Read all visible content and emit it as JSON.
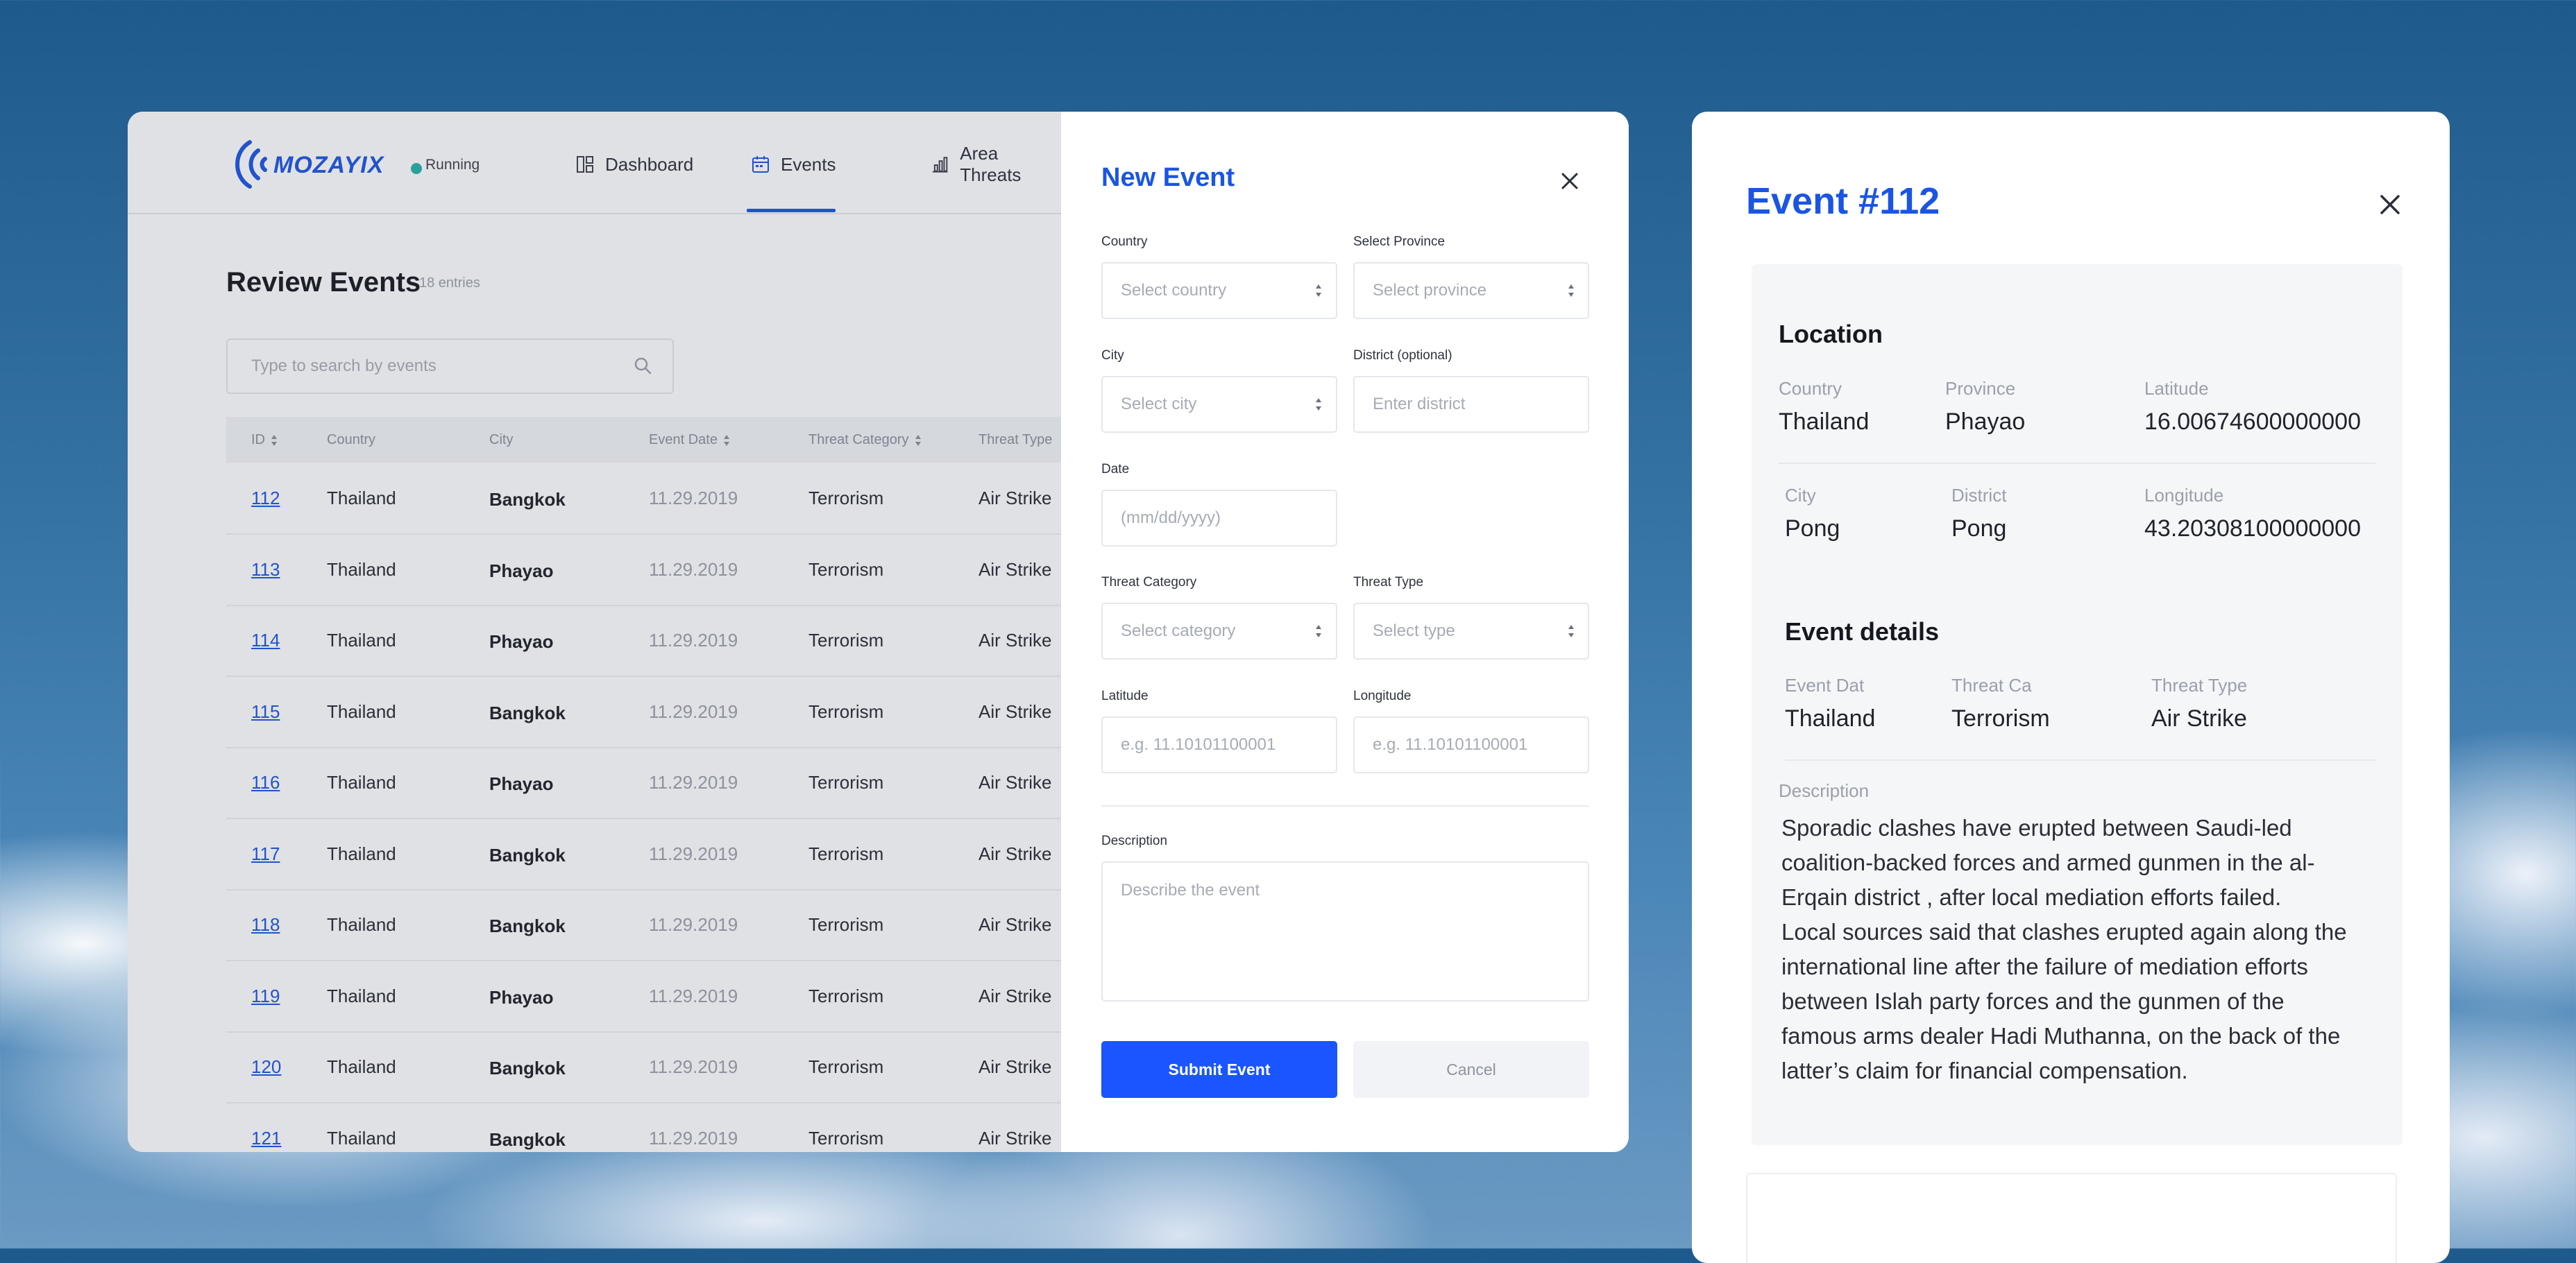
{
  "app": {
    "brand": "MOZAYIX",
    "status": "Running",
    "nav": [
      {
        "label": "Dashboard",
        "icon": "dashboard-icon"
      },
      {
        "label": "Events",
        "icon": "calendar-icon",
        "active": true
      },
      {
        "label": "Area Threats",
        "icon": "bar-chart-icon"
      }
    ],
    "page_title": "Review Events",
    "entries": "18 entries",
    "search_placeholder": "Type to search by events",
    "columns": [
      "ID",
      "Country",
      "City",
      "Event Date",
      "Threat Category",
      "Threat Type"
    ],
    "rows": [
      {
        "id": "112",
        "country": "Thailand",
        "city": "Bangkok",
        "date": "11.29.2019",
        "category": "Terrorism",
        "type": "Air Strike"
      },
      {
        "id": "113",
        "country": "Thailand",
        "city": "Phayao",
        "date": "11.29.2019",
        "category": "Terrorism",
        "type": "Air Strike"
      },
      {
        "id": "114",
        "country": "Thailand",
        "city": "Phayao",
        "date": "11.29.2019",
        "category": "Terrorism",
        "type": "Air Strike"
      },
      {
        "id": "115",
        "country": "Thailand",
        "city": "Bangkok",
        "date": "11.29.2019",
        "category": "Terrorism",
        "type": "Air Strike"
      },
      {
        "id": "116",
        "country": "Thailand",
        "city": "Phayao",
        "date": "11.29.2019",
        "category": "Terrorism",
        "type": "Air Strike"
      },
      {
        "id": "117",
        "country": "Thailand",
        "city": "Bangkok",
        "date": "11.29.2019",
        "category": "Terrorism",
        "type": "Air Strike"
      },
      {
        "id": "118",
        "country": "Thailand",
        "city": "Bangkok",
        "date": "11.29.2019",
        "category": "Terrorism",
        "type": "Air Strike"
      },
      {
        "id": "119",
        "country": "Thailand",
        "city": "Phayao",
        "date": "11.29.2019",
        "category": "Terrorism",
        "type": "Air Strike"
      },
      {
        "id": "120",
        "country": "Thailand",
        "city": "Bangkok",
        "date": "11.29.2019",
        "category": "Terrorism",
        "type": "Air Strike"
      },
      {
        "id": "121",
        "country": "Thailand",
        "city": "Bangkok",
        "date": "11.29.2019",
        "category": "Terrorism",
        "type": "Air Strike"
      }
    ]
  },
  "form": {
    "title": "New Event",
    "country_label": "Country",
    "country_placeholder": "Select country",
    "province_label": "Select Province",
    "province_placeholder": "Select province",
    "city_label": "City",
    "city_placeholder": "Select city",
    "district_label": "District (optional)",
    "district_placeholder": "Enter district",
    "date_label": "Date",
    "date_placeholder": "(mm/dd/yyyy)",
    "category_label": "Threat Category",
    "category_placeholder": "Select category",
    "type_label": "Threat Type",
    "type_placeholder": "Select type",
    "latitude_label": "Latitude",
    "latitude_placeholder": "e.g. 11.10101100001",
    "longitude_label": "Longitude",
    "longitude_placeholder": "e.g. 11.10101100001",
    "description_label": "Description",
    "description_placeholder": "Describe the event",
    "submit_label": "Submit Event",
    "cancel_label": "Cancel"
  },
  "detail": {
    "title": "Event #112",
    "location_title": "Location",
    "country_label": "Country",
    "country_value": "Thailand",
    "province_label": "Province",
    "province_value": "Phayao",
    "latitude_label": "Latitude",
    "latitude_value": "16.00674600000000",
    "city_label": "City",
    "city_value": "Pong",
    "district_label": "District",
    "district_value": "Pong",
    "longitude_label": "Longitude",
    "longitude_value": "43.20308100000000",
    "event_details_title": "Event details",
    "event_date_label": "Event Dat",
    "event_date_value": "Thailand",
    "threat_category_label": "Threat Ca",
    "threat_category_value": "Terrorism",
    "threat_type_label": "Threat Type",
    "threat_type_value": "Air Strike",
    "description_label": "Description",
    "description_lines": [
      "Sporadic clashes have erupted  between Saudi-led",
      "coalition-backed forces and armed gunmen in the al-",
      "Erqain district , after local mediation efforts failed.",
      "Local sources said that clashes erupted again along the",
      "international line after the failure of mediation efforts",
      "between Islah party forces and the gunmen of the",
      "famous arms dealer Hadi Muthanna, on the back of the",
      "latter’s claim for financial compensation."
    ]
  },
  "colors": {
    "accent": "#1a55e3",
    "submit": "#1a55ff",
    "status": "#20b4a7"
  }
}
